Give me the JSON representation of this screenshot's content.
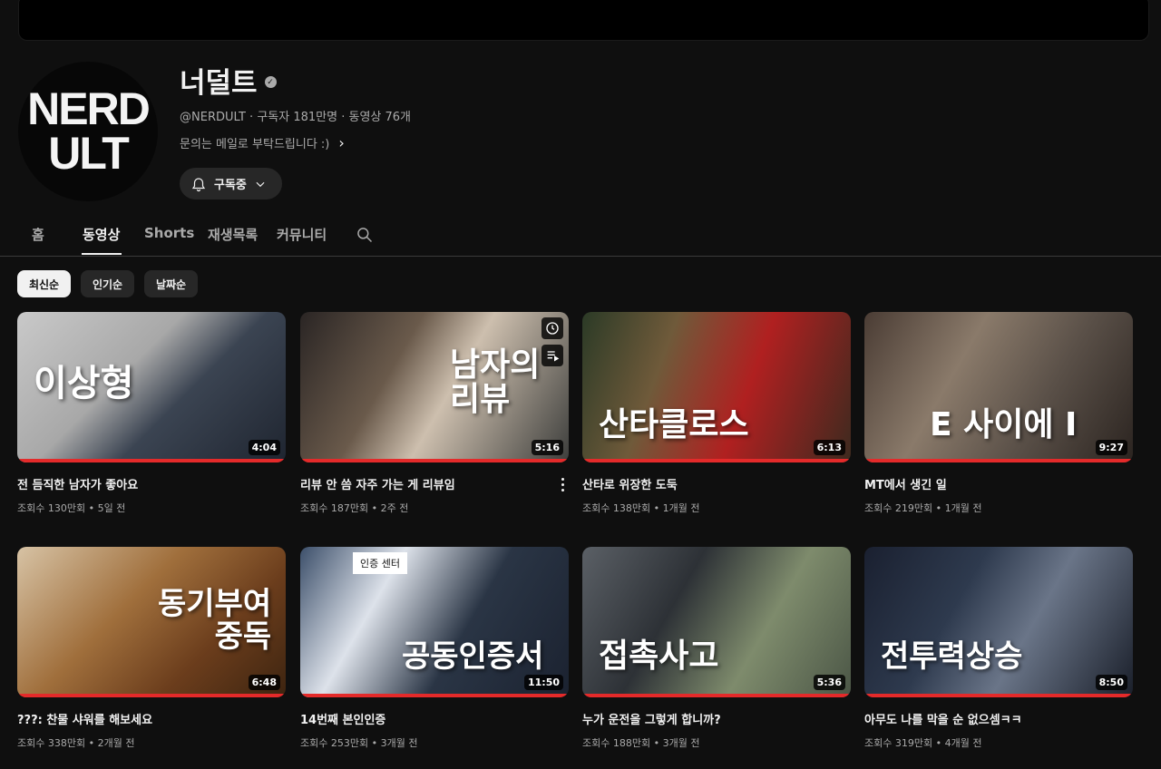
{
  "channel": {
    "logo_text_line1": "NERD",
    "logo_text_line2": "ULT",
    "name": "너덜트",
    "handle": "@NERDULT",
    "subscribers": "구독자 181만명",
    "video_count": "동영상 76개",
    "separator": "‧",
    "description": "문의는 메일로 부탁드립니다 :)",
    "subscribe_label": "구독중"
  },
  "tabs": [
    {
      "label": "홈"
    },
    {
      "label": "동영상"
    },
    {
      "label": "Shorts"
    },
    {
      "label": "재생목록"
    },
    {
      "label": "커뮤니티"
    }
  ],
  "chips": [
    {
      "label": "최신순"
    },
    {
      "label": "인기순"
    },
    {
      "label": "날짜순"
    }
  ],
  "videos": [
    {
      "title": "전 듬직한 남자가 좋아요",
      "views": "조회수 130만회",
      "age": "5일 전",
      "duration": "4:04",
      "overlay": "이상형"
    },
    {
      "title": "리뷰 안 씀 자주 가는 게 리뷰임",
      "views": "조회수 187만회",
      "age": "2주 전",
      "duration": "5:16",
      "overlay": "남자의\n리뷰"
    },
    {
      "title": "산타로 위장한 도둑",
      "views": "조회수 138만회",
      "age": "1개월 전",
      "duration": "6:13",
      "overlay": "산타클로스"
    },
    {
      "title": "MT에서 생긴 일",
      "views": "조회수 219만회",
      "age": "1개월 전",
      "duration": "9:27",
      "overlay": "E 사이에 I"
    },
    {
      "title": "???: 찬물 샤워를 해보세요",
      "views": "조회수 338만회",
      "age": "2개월 전",
      "duration": "6:48",
      "overlay": "동기부여\n중독"
    },
    {
      "title": "14번째 본인인증",
      "views": "조회수 253만회",
      "age": "3개월 전",
      "duration": "11:50",
      "overlay": "공동인증서",
      "sign": "인증 센터"
    },
    {
      "title": "누가 운전을 그렇게 합니까?",
      "views": "조회수 188만회",
      "age": "3개월 전",
      "duration": "5:36",
      "overlay": "접촉사고"
    },
    {
      "title": "아무도 나를 막을 순 없으셈ㅋㅋ",
      "views": "조회수 319만회",
      "age": "4개월 전",
      "duration": "8:50",
      "overlay": "전투력상승"
    }
  ],
  "meta_separator": "•",
  "colors": {
    "background": "#0f0f0f",
    "progress": "#e42a2a",
    "chip_active": "#f1f1f1"
  }
}
